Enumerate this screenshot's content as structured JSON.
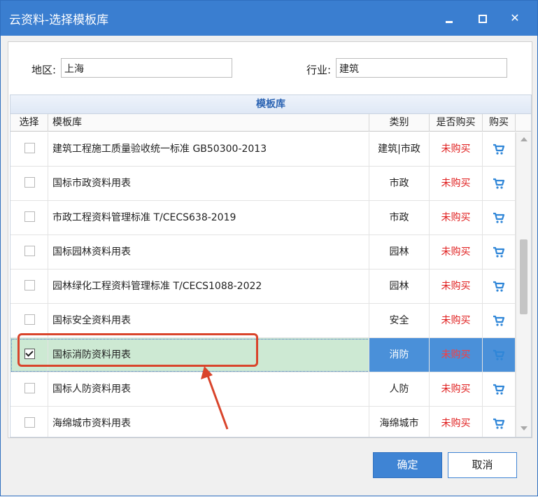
{
  "window": {
    "title": "云资料-选择模板库"
  },
  "filters": {
    "region_label": "地区:",
    "region_value": "上海",
    "industry_label": "行业:",
    "industry_value": "建筑"
  },
  "grid": {
    "title": "模板库",
    "headers": [
      "选择",
      "模板库",
      "类别",
      "是否购买",
      "购买"
    ],
    "rows": [
      {
        "checked": false,
        "name": "建筑工程施工质量验收统一标准 GB50300-2013",
        "category": "建筑|市政",
        "status": "未购买"
      },
      {
        "checked": false,
        "name": "国标市政资料用表",
        "category": "市政",
        "status": "未购买"
      },
      {
        "checked": false,
        "name": "市政工程资料管理标准 T/CECS638-2019",
        "category": "市政",
        "status": "未购买"
      },
      {
        "checked": false,
        "name": "国标园林资料用表",
        "category": "园林",
        "status": "未购买"
      },
      {
        "checked": false,
        "name": "园林绿化工程资料管理标准 T/CECS1088-2022",
        "category": "园林",
        "status": "未购买"
      },
      {
        "checked": false,
        "name": "国标安全资料用表",
        "category": "安全",
        "status": "未购买"
      },
      {
        "checked": true,
        "name": "国标消防资料用表",
        "category": "消防",
        "status": "未购买",
        "selected": true
      },
      {
        "checked": false,
        "name": "国标人防资料用表",
        "category": "人防",
        "status": "未购买"
      },
      {
        "checked": false,
        "name": "海绵城市资料用表",
        "category": "海绵城市",
        "status": "未购买"
      }
    ]
  },
  "buttons": {
    "ok": "确定",
    "cancel": "取消"
  },
  "colors": {
    "titlebar": "#3a7ed0",
    "status_red": "#e02020",
    "cart_blue": "#2f86d8",
    "selected_row": "#cde9d3",
    "annotation": "#d9442b"
  },
  "icons": {
    "cart": "cart-icon",
    "minimize": "minimize-icon",
    "maximize": "maximize-icon",
    "close": "close-icon"
  }
}
